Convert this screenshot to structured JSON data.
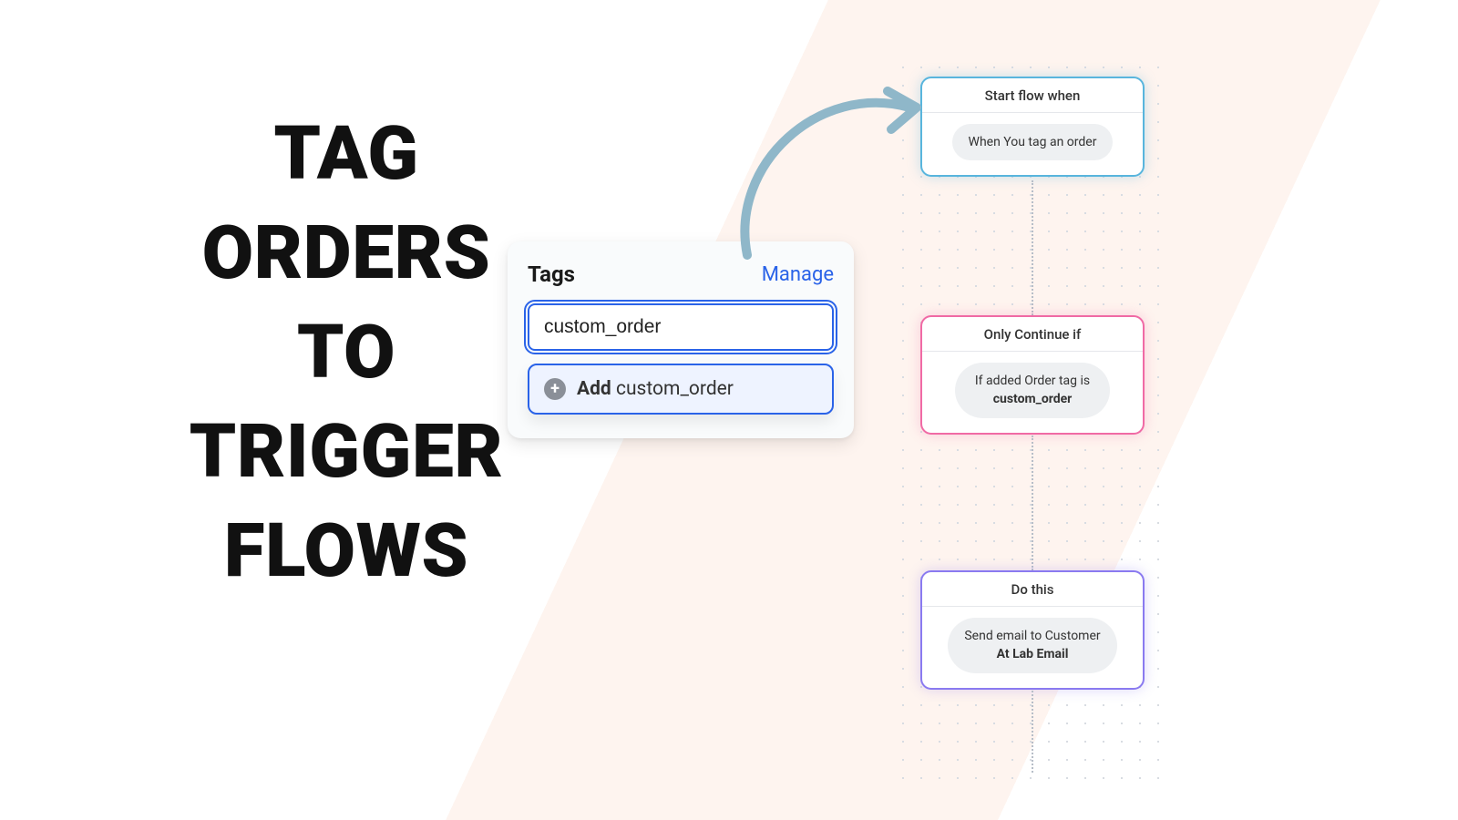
{
  "headline": {
    "line1": "TAG",
    "line2": "ORDERS",
    "line3": "TO",
    "line4": "TRIGGER",
    "line5": "FLOWS"
  },
  "tagsPanel": {
    "title": "Tags",
    "manage": "Manage",
    "inputValue": "custom_order",
    "addPrefix": "Add",
    "addValue": "custom_order"
  },
  "flow": {
    "node1": {
      "header": "Start flow when",
      "pill": "When You tag an order"
    },
    "node2": {
      "header": "Only Continue if",
      "pillLine1": "If added Order tag is",
      "pillBold": "custom_order"
    },
    "node3": {
      "header": "Do this",
      "pillLine1": "Send email to Customer",
      "pillBold": "At Lab Email"
    }
  }
}
